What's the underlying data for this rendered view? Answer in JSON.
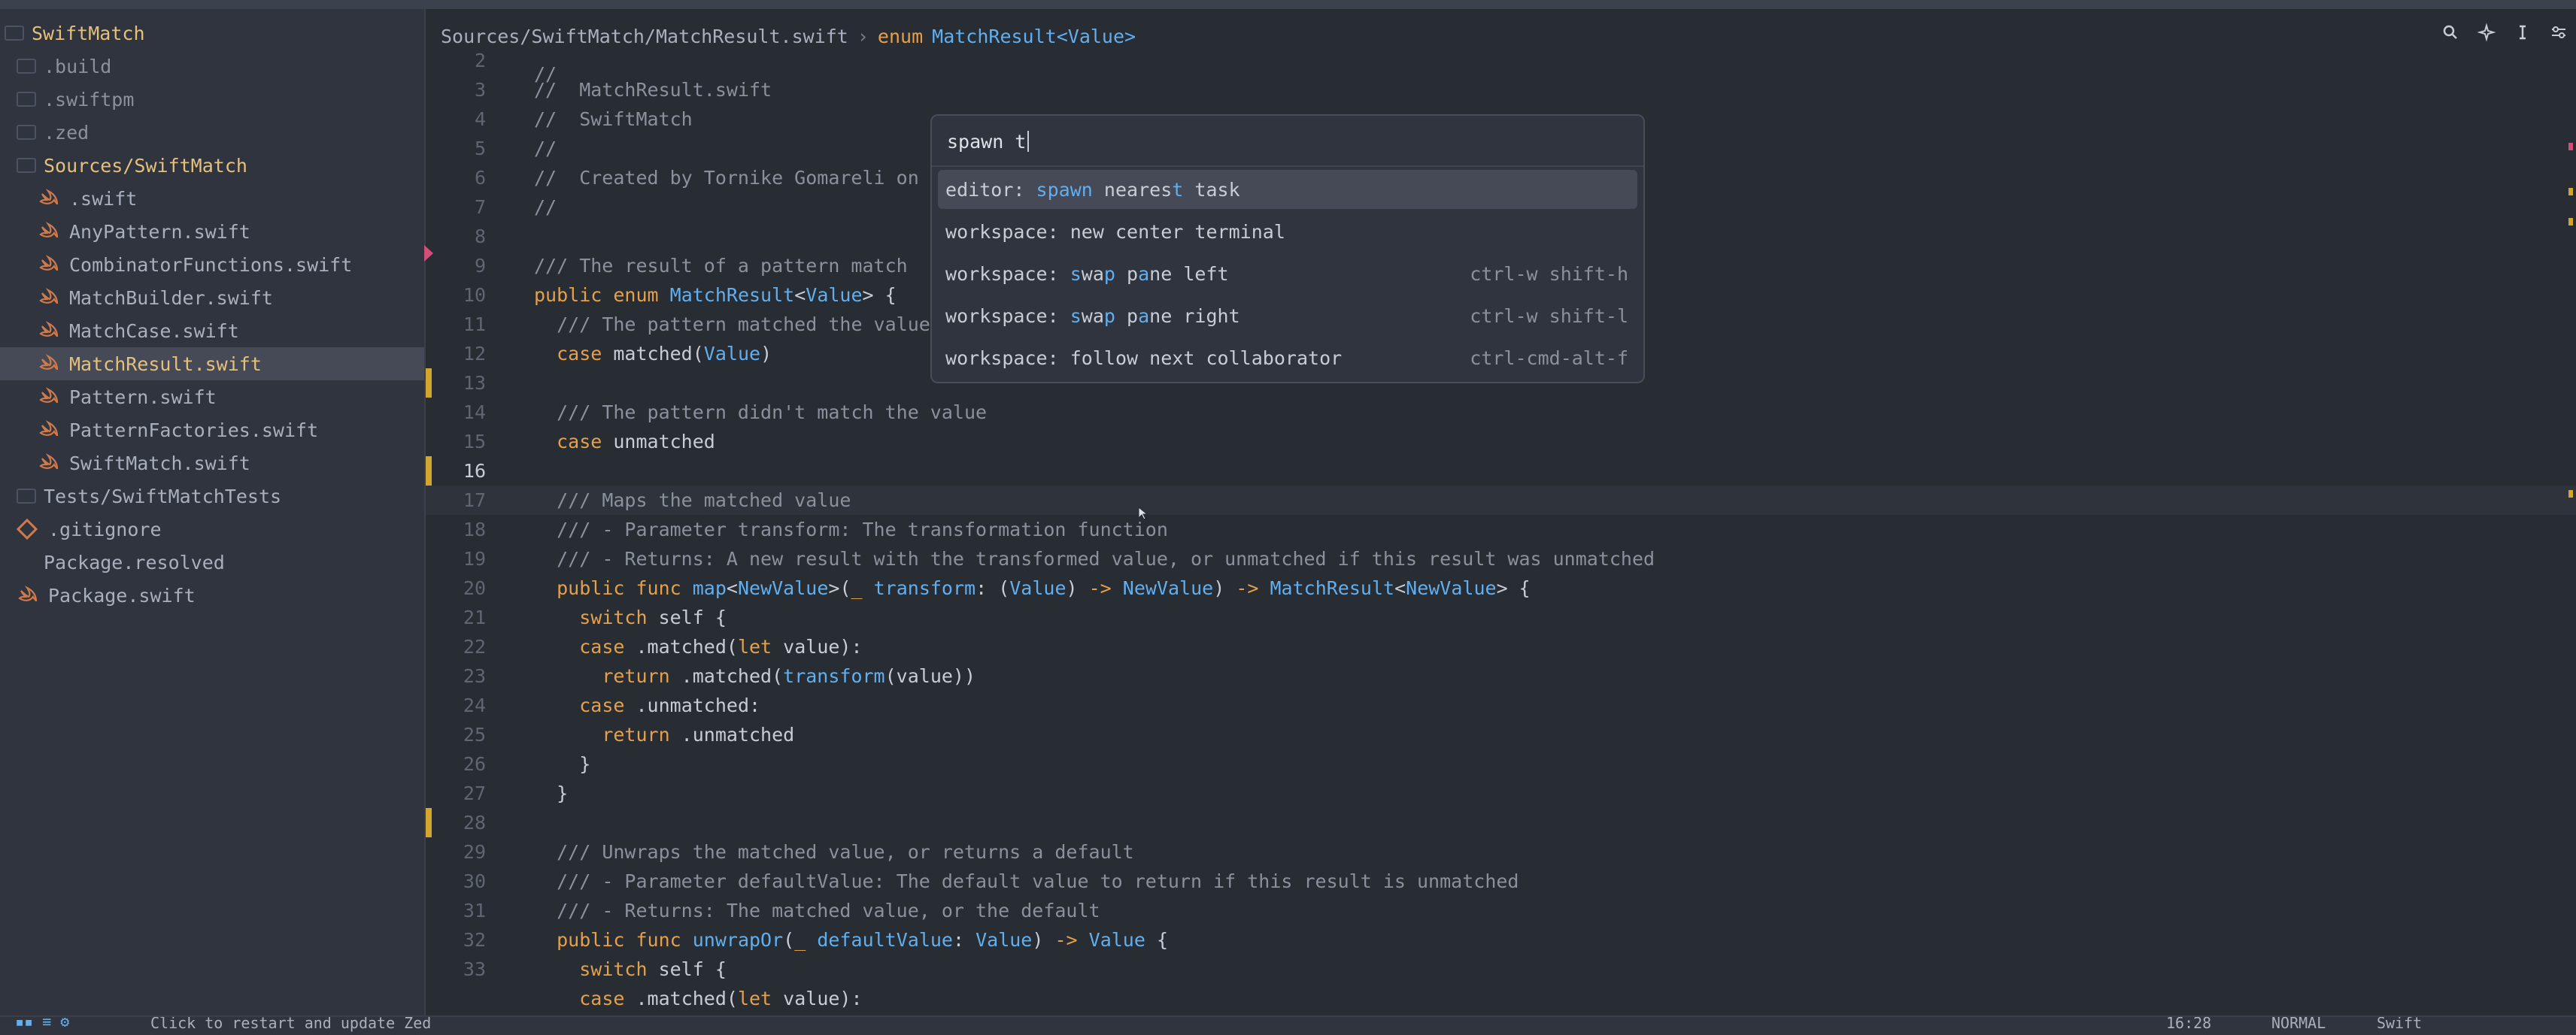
{
  "project": {
    "name": "SwiftMatch"
  },
  "sidebar": {
    "items": [
      {
        "label": "SwiftMatch",
        "kind": "root-folder"
      },
      {
        "label": ".build",
        "kind": "folder"
      },
      {
        "label": ".swiftpm",
        "kind": "folder"
      },
      {
        "label": ".zed",
        "kind": "folder"
      },
      {
        "label": "Sources/SwiftMatch",
        "kind": "open-folder"
      },
      {
        "label": ".swift",
        "kind": "swift-file"
      },
      {
        "label": "AnyPattern.swift",
        "kind": "swift-file"
      },
      {
        "label": "CombinatorFunctions.swift",
        "kind": "swift-file"
      },
      {
        "label": "MatchBuilder.swift",
        "kind": "swift-file"
      },
      {
        "label": "MatchCase.swift",
        "kind": "swift-file"
      },
      {
        "label": "MatchResult.swift",
        "kind": "swift-file-selected"
      },
      {
        "label": "Pattern.swift",
        "kind": "swift-file"
      },
      {
        "label": "PatternFactories.swift",
        "kind": "swift-file"
      },
      {
        "label": "SwiftMatch.swift",
        "kind": "swift-file"
      },
      {
        "label": "Tests/SwiftMatchTests",
        "kind": "folder"
      },
      {
        "label": ".gitignore",
        "kind": "git-file"
      },
      {
        "label": "Package.resolved",
        "kind": "plain-file"
      },
      {
        "label": "Package.swift",
        "kind": "swift-file"
      }
    ]
  },
  "breadcrumb": {
    "path": "Sources/SwiftMatch/MatchResult.swift",
    "separator": "›",
    "keyword": "enum",
    "symbol": "MatchResult",
    "generic": "<Value>"
  },
  "editor": {
    "line_numbers": [
      "2",
      "3",
      "4",
      "5",
      "6",
      "7",
      "8",
      "9",
      "10",
      "11",
      "12",
      "13",
      "14",
      "15",
      "16",
      "17",
      "18",
      "19",
      "20",
      "21",
      "22",
      "23",
      "24",
      "25",
      "26",
      "27",
      "28",
      "29",
      "30",
      "31",
      "32",
      "33"
    ],
    "current_line": "16"
  },
  "palette": {
    "query": "spawn t",
    "commands": [
      {
        "prefix": "editor: ",
        "label": "spawn nearest task",
        "keybinding": ""
      },
      {
        "prefix": "workspace: ",
        "label": "new center terminal",
        "keybinding": ""
      },
      {
        "prefix": "workspace: ",
        "label": "swap pane left",
        "keybinding": "ctrl-w shift-h"
      },
      {
        "prefix": "workspace: ",
        "label": "swap pane right",
        "keybinding": "ctrl-w shift-l"
      },
      {
        "prefix": "workspace: ",
        "label": "follow next collaborator",
        "keybinding": "ctrl-cmd-alt-f"
      }
    ]
  },
  "statusbar": {
    "message": "Click to restart and update Zed",
    "position": "16:28",
    "mode": "NORMAL",
    "language": "Swift"
  },
  "colors": {
    "background": "#282c33",
    "sidebar": "#2f343e",
    "accent": "#61afef",
    "keyword": "#e5a04b",
    "folder": "#e5c07b",
    "git_modified": "#d2a52f"
  }
}
